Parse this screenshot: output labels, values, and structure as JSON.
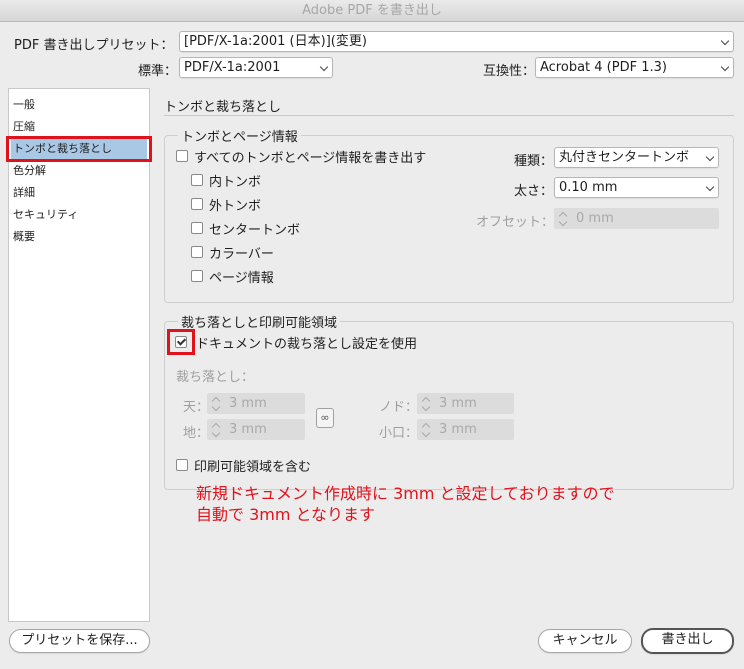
{
  "window": {
    "title": "Adobe PDF を書き出し"
  },
  "header": {
    "preset_label": "PDF 書き出しプリセット：",
    "preset_value": "[PDF/X-1a:2001 (日本)](変更)",
    "standard_label": "標準：",
    "standard_value": "PDF/X-1a:2001",
    "compat_label": "互換性：",
    "compat_value": "Acrobat 4 (PDF 1.3)"
  },
  "sidebar": {
    "items": [
      {
        "label": "一般"
      },
      {
        "label": "圧縮"
      },
      {
        "label": "トンボと裁ち落とし"
      },
      {
        "label": "色分解"
      },
      {
        "label": "詳細"
      },
      {
        "label": "セキュリティ"
      },
      {
        "label": "概要"
      }
    ]
  },
  "main": {
    "section_title": "トンボと裁ち落とし",
    "marks": {
      "title": "トンボとページ情報",
      "all_marks": "すべてのトンボとページ情報を書き出す",
      "options": [
        "内トンボ",
        "外トンボ",
        "センタートンボ",
        "カラーバー",
        "ページ情報"
      ],
      "type_label": "種類：",
      "type_value": "丸付きセンタートンボ",
      "weight_label": "太さ：",
      "weight_value": "0.10 mm",
      "offset_label": "オフセット：",
      "offset_value": "0 mm"
    },
    "bleed": {
      "title": "裁ち落としと印刷可能領域",
      "use_doc_bleed": "ドキュメントの裁ち落とし設定を使用",
      "bleed_label": "裁ち落とし：",
      "top_label": "天：",
      "top_value": "3 mm",
      "bottom_label": "地：",
      "bottom_value": "3 mm",
      "inside_label": "ノド：",
      "inside_value": "3 mm",
      "outside_label": "小口：",
      "outside_value": "3 mm",
      "link_icon": "link-icon",
      "include_slug": "印刷可能領域を含む"
    },
    "annotation": {
      "line1": "新規ドキュメント作成時に 3mm と設定しておりますので",
      "line2": "自動で 3mm となります",
      "color": "#e0131d"
    }
  },
  "footer": {
    "save_preset": "プリセットを保存...",
    "cancel": "キャンセル",
    "export": "書き出し"
  }
}
